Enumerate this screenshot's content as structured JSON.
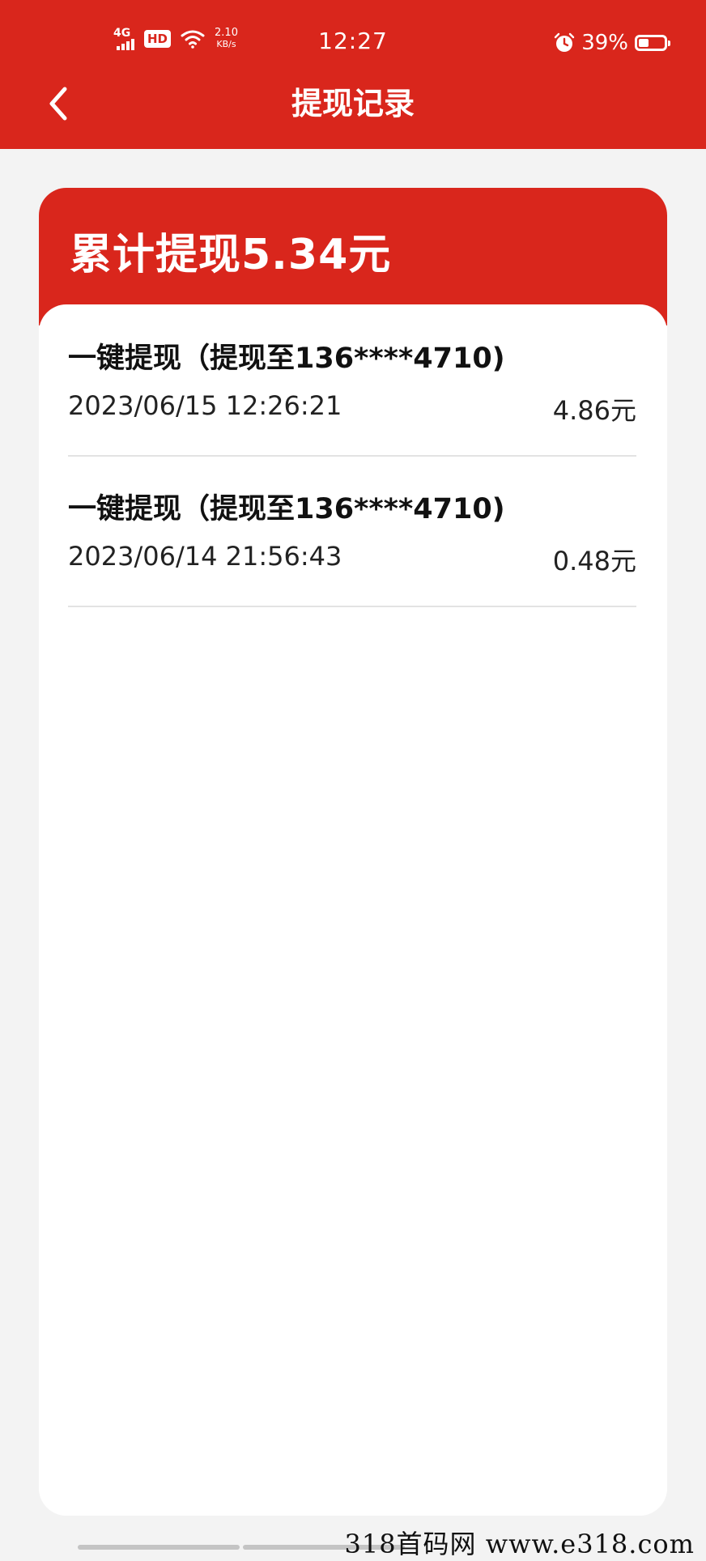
{
  "status_bar": {
    "network": "4G",
    "hd": "HD",
    "speed_value": "2.10",
    "speed_unit": "KB/s",
    "time": "12:27",
    "battery_text": "39%",
    "battery_level": 0.39,
    "icons": [
      "signal-icon",
      "wifi-icon",
      "alarm-icon",
      "battery-icon"
    ]
  },
  "header": {
    "title": "提现记录",
    "back_icon": "chevron-left-icon"
  },
  "summary": {
    "text": "累计提现5.34元"
  },
  "records": [
    {
      "title": "一键提现（提现至136****4710)",
      "time": "2023/06/15 12:26:21",
      "amount": "4.86元"
    },
    {
      "title": "一键提现（提现至136****4710)",
      "time": "2023/06/14 21:56:43",
      "amount": "0.48元"
    }
  ],
  "watermark": "318首码网  www.e318.com",
  "colors": {
    "brand_red": "#d9261c",
    "background": "#f3f3f3",
    "card": "#ffffff",
    "divider": "#e3e3e3"
  }
}
